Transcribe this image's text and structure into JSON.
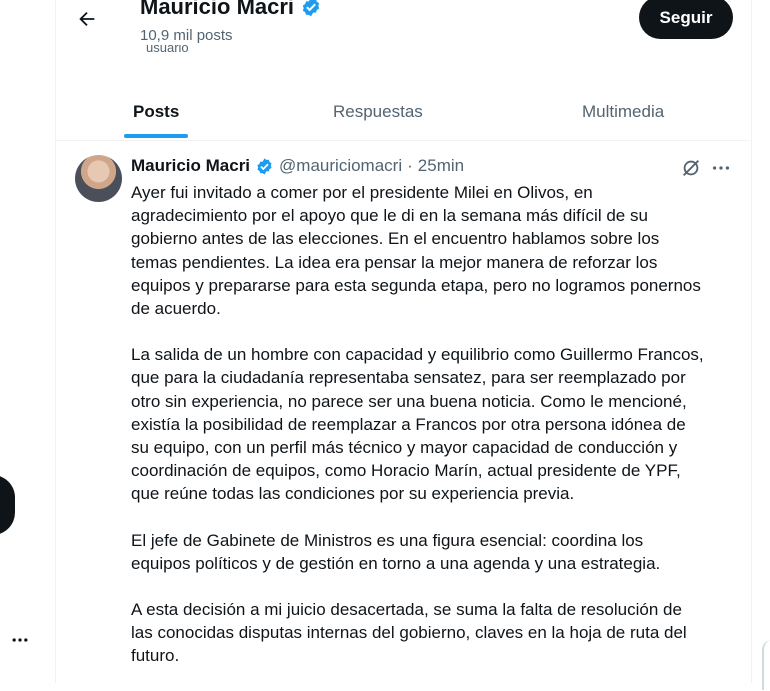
{
  "profile": {
    "name": "Mauricio Macri",
    "posts_count": "10,9 mil posts",
    "peek_text": "usuario",
    "follow_label": "Seguir"
  },
  "tabs": [
    {
      "label": "Posts",
      "active": true
    },
    {
      "label": "Respuestas",
      "active": false
    },
    {
      "label": "Multimedia",
      "active": false
    }
  ],
  "tweet": {
    "author": "Mauricio Macri",
    "handle": "@mauriciomacri",
    "separator": "·",
    "time": "25min",
    "paragraphs": [
      "Ayer fui invitado a comer por el presidente Milei en Olivos, en\nagradecimiento por el apoyo que le di en la semana más difícil de su\ngobierno antes de las elecciones. En el encuentro hablamos sobre los\ntemas pendientes. La idea era pensar la mejor manera de reforzar los\nequipos y prepararse para esta segunda etapa, pero no logramos ponernos\nde acuerdo.",
      "La salida de un hombre con capacidad y equilibrio como Guillermo Francos,\nque para la ciudadanía representaba sensatez, para ser reemplazado por\notro sin experiencia, no parece ser una buena noticia. Como le mencioné,\nexistía la posibilidad de reemplazar a Francos por otra persona idónea de\nsu equipo, con un perfil más técnico y mayor capacidad de conducción y\ncoordinación de equipos, como Horacio Marín, actual presidente de YPF,\nque reúne todas las condiciones por su experiencia previa.",
      "El jefe de Gabinete de Ministros es una figura esencial: coordina los\nequipos políticos y de gestión en torno a una agenda y una estrategia.",
      "A esta decisión a mi juicio desacertada, se suma la falta de resolución de\nlas conocidas disputas internas del gobierno, claves en la hoja de ruta del\nfuturo."
    ]
  },
  "colors": {
    "accent": "#1d9bf0",
    "text": "#0f1419",
    "muted": "#536471",
    "border": "#eff3f4"
  },
  "icons": [
    "back-arrow-icon",
    "verified-badge-icon",
    "grok-icon",
    "more-icon"
  ]
}
